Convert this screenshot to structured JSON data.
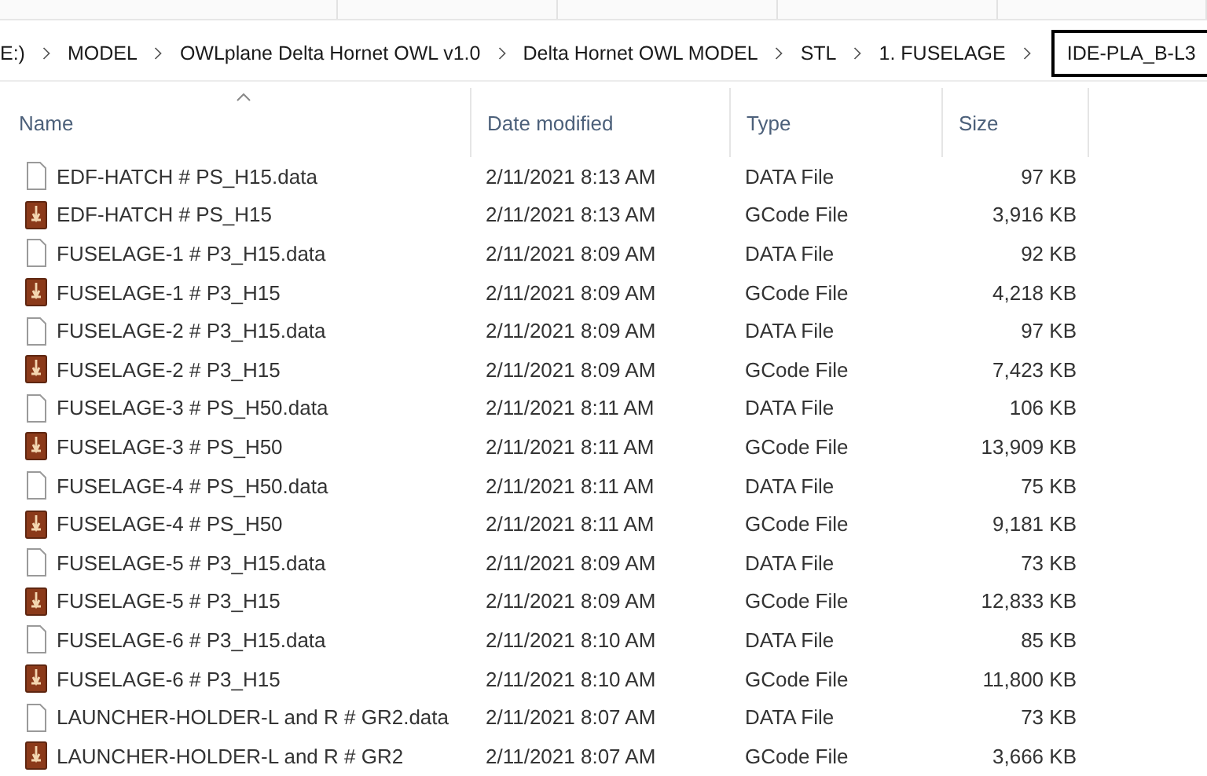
{
  "breadcrumb": [
    {
      "label": "E:)",
      "selected": false
    },
    {
      "label": "MODEL",
      "selected": false
    },
    {
      "label": "OWLplane Delta Hornet OWL v1.0",
      "selected": false
    },
    {
      "label": "Delta Hornet OWL MODEL",
      "selected": false
    },
    {
      "label": "STL",
      "selected": false
    },
    {
      "label": "1. FUSELAGE",
      "selected": false
    },
    {
      "label": "IDE-PLA_B-L3",
      "selected": true
    }
  ],
  "columns": [
    {
      "label": "Name",
      "sorted": true
    },
    {
      "label": "Date modified",
      "sorted": false
    },
    {
      "label": "Type",
      "sorted": false
    },
    {
      "label": "Size",
      "sorted": false
    }
  ],
  "rows": [
    {
      "kind": "data",
      "name": "EDF-HATCH # PS_H15.data",
      "date": "2/11/2021 8:13 AM",
      "type": "DATA File",
      "size": "97 KB"
    },
    {
      "kind": "gcode",
      "name": "EDF-HATCH # PS_H15",
      "date": "2/11/2021 8:13 AM",
      "type": "GCode File",
      "size": "3,916 KB"
    },
    {
      "kind": "data",
      "name": "FUSELAGE-1 # P3_H15.data",
      "date": "2/11/2021 8:09 AM",
      "type": "DATA File",
      "size": "92 KB"
    },
    {
      "kind": "gcode",
      "name": "FUSELAGE-1 # P3_H15",
      "date": "2/11/2021 8:09 AM",
      "type": "GCode File",
      "size": "4,218 KB"
    },
    {
      "kind": "data",
      "name": "FUSELAGE-2 # P3_H15.data",
      "date": "2/11/2021 8:09 AM",
      "type": "DATA File",
      "size": "97 KB"
    },
    {
      "kind": "gcode",
      "name": "FUSELAGE-2 # P3_H15",
      "date": "2/11/2021 8:09 AM",
      "type": "GCode File",
      "size": "7,423 KB"
    },
    {
      "kind": "data",
      "name": "FUSELAGE-3 # PS_H50.data",
      "date": "2/11/2021 8:11 AM",
      "type": "DATA File",
      "size": "106 KB"
    },
    {
      "kind": "gcode",
      "name": "FUSELAGE-3 # PS_H50",
      "date": "2/11/2021 8:11 AM",
      "type": "GCode File",
      "size": "13,909 KB"
    },
    {
      "kind": "data",
      "name": "FUSELAGE-4 # PS_H50.data",
      "date": "2/11/2021 8:11 AM",
      "type": "DATA File",
      "size": "75 KB"
    },
    {
      "kind": "gcode",
      "name": "FUSELAGE-4 # PS_H50",
      "date": "2/11/2021 8:11 AM",
      "type": "GCode File",
      "size": "9,181 KB"
    },
    {
      "kind": "data",
      "name": "FUSELAGE-5 # P3_H15.data",
      "date": "2/11/2021 8:09 AM",
      "type": "DATA File",
      "size": "73 KB"
    },
    {
      "kind": "gcode",
      "name": "FUSELAGE-5 # P3_H15",
      "date": "2/11/2021 8:09 AM",
      "type": "GCode File",
      "size": "12,833 KB"
    },
    {
      "kind": "data",
      "name": "FUSELAGE-6 # P3_H15.data",
      "date": "2/11/2021 8:10 AM",
      "type": "DATA File",
      "size": "85 KB"
    },
    {
      "kind": "gcode",
      "name": "FUSELAGE-6 # P3_H15",
      "date": "2/11/2021 8:10 AM",
      "type": "GCode File",
      "size": "11,800 KB"
    },
    {
      "kind": "data",
      "name": "LAUNCHER-HOLDER-L and R # GR2.data",
      "date": "2/11/2021 8:07 AM",
      "type": "DATA File",
      "size": "73 KB"
    },
    {
      "kind": "gcode",
      "name": "LAUNCHER-HOLDER-L and R # GR2",
      "date": "2/11/2021 8:07 AM",
      "type": "GCode File",
      "size": "3,666 KB"
    }
  ]
}
